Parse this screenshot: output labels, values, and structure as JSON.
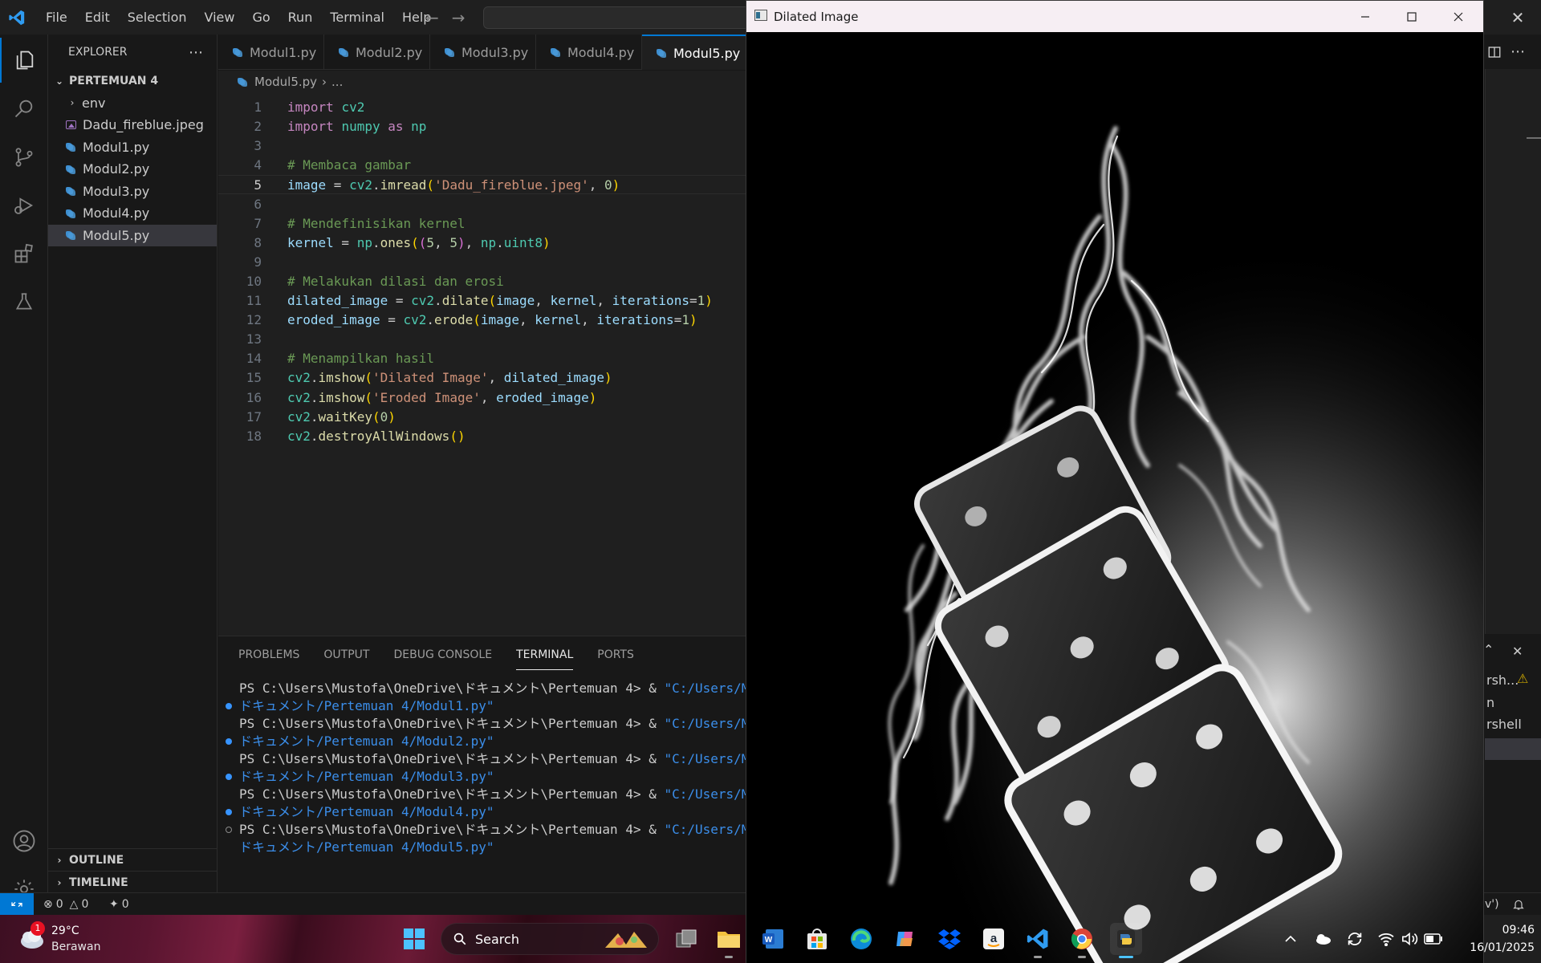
{
  "menu": [
    "File",
    "Edit",
    "Selection",
    "View",
    "Go",
    "Run",
    "Terminal",
    "Help"
  ],
  "explorer": {
    "header": "EXPLORER",
    "folder": "PERTEMUAN 4",
    "items": [
      {
        "label": "env",
        "type": "folder"
      },
      {
        "label": "Dadu_fireblue.jpeg",
        "type": "image"
      },
      {
        "label": "Modul1.py",
        "type": "python"
      },
      {
        "label": "Modul2.py",
        "type": "python"
      },
      {
        "label": "Modul3.py",
        "type": "python"
      },
      {
        "label": "Modul4.py",
        "type": "python"
      },
      {
        "label": "Modul5.py",
        "type": "python",
        "selected": true
      }
    ],
    "outline": "OUTLINE",
    "timeline": "TIMELINE"
  },
  "tabs": [
    "Modul1.py",
    "Modul2.py",
    "Modul3.py",
    "Modul4.py",
    "Modul5.py"
  ],
  "breadcrumb": {
    "file": "Modul5.py",
    "rest": "..."
  },
  "editor": {
    "current_line": 5,
    "lines": [
      "import cv2",
      "import numpy as np",
      "",
      "# Membaca gambar",
      "image = cv2.imread('Dadu_fireblue.jpeg', 0)",
      "",
      "# Mendefinisikan kernel",
      "kernel = np.ones((5, 5), np.uint8)",
      "",
      "# Melakukan dilasi dan erosi",
      "dilated_image = cv2.dilate(image, kernel, iterations=1)",
      "eroded_image = cv2.erode(image, kernel, iterations=1)",
      "",
      "# Menampilkan hasil",
      "cv2.imshow('Dilated Image', dilated_image)",
      "cv2.imshow('Eroded Image', eroded_image)",
      "cv2.waitKey(0)",
      "cv2.destroyAllWindows()"
    ]
  },
  "panel": {
    "tabs": [
      "PROBLEMS",
      "OUTPUT",
      "DEBUG CONSOLE",
      "TERMINAL",
      "PORTS"
    ],
    "active_tab": "TERMINAL",
    "prompt": "PS C:\\Users\\Mustofa\\OneDrive\\ドキュメント\\Pertemuan 4> & ",
    "cmd_head": "\"C:/Users/Mus",
    "runs": [
      "ドキュメント/Pertemuan 4/Modul1.py\"",
      "ドキュメント/Pertemuan 4/Modul2.py\"",
      "ドキュメント/Pertemuan 4/Modul3.py\"",
      "ドキュメント/Pertemuan 4/Modul4.py\"",
      "ドキュメント/Pertemuan 4/Modul5.py\""
    ]
  },
  "right_strip": {
    "items": [
      "rsh...",
      "n",
      "rshell",
      "n"
    ],
    "status": "v')"
  },
  "status": {
    "errors": "0",
    "warnings": "0",
    "ports": "0"
  },
  "cv_window": {
    "title": "Dilated Image"
  },
  "taskbar": {
    "weather_temp": "29°C",
    "weather_desc": "Berawan",
    "weather_badge": "1",
    "search_label": "Search",
    "time": "09:46",
    "date": "16/01/2025"
  },
  "colors": {
    "accent": "#0078d4",
    "editor_bg": "#1f1f1f",
    "chrome_bg": "#181818"
  }
}
